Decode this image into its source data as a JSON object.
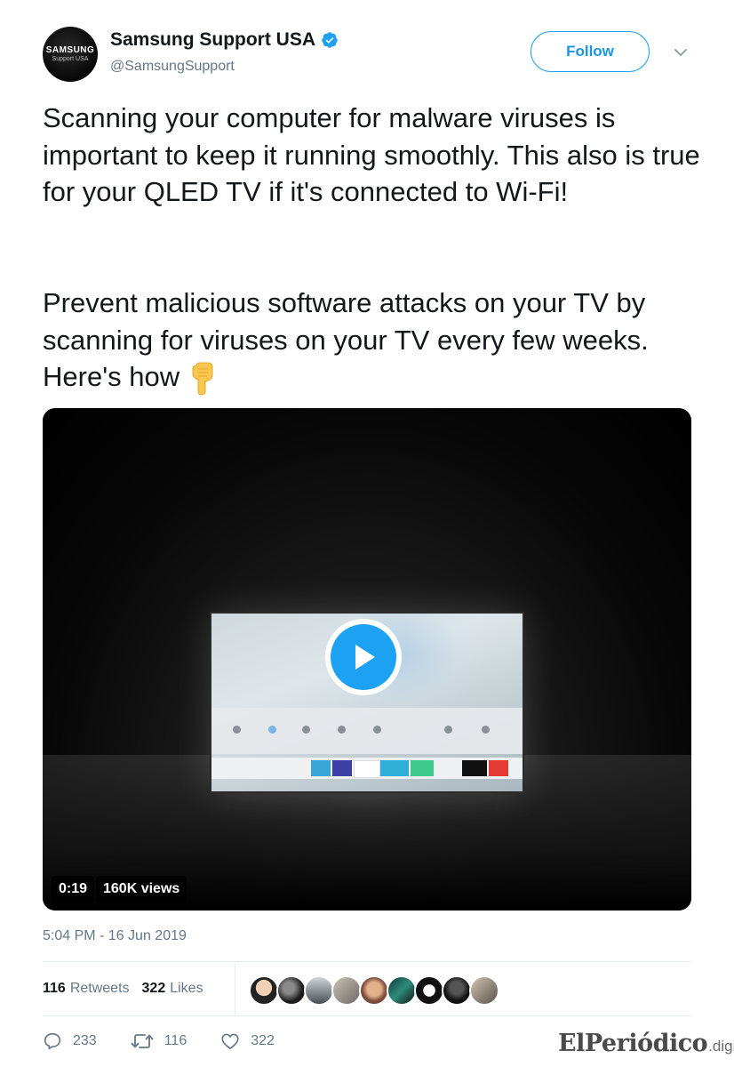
{
  "account": {
    "avatar_brand": "SAMSUNG",
    "avatar_sub": "Support USA",
    "display_name": "Samsung Support USA",
    "handle": "@SamsungSupport",
    "verified": true
  },
  "header": {
    "follow_label": "Follow"
  },
  "tweet": {
    "paragraph_1": "Scanning your computer for malware viruses is important to keep it running smoothly. This also is true for your QLED TV if it's connected to Wi-Fi!",
    "paragraph_2": "Prevent malicious software attacks on your TV by scanning for viruses on your TV every few weeks. Here's how",
    "emoji": "backhand-index-pointing-down"
  },
  "video": {
    "duration": "0:19",
    "views": "160K views"
  },
  "meta": {
    "timestamp": "5:04 PM - 16 Jun 2019"
  },
  "stats": {
    "retweets_count": "116",
    "retweets_label": "Retweets",
    "likes_count": "322",
    "likes_label": "Likes"
  },
  "actions": {
    "replies": "233",
    "retweets": "116",
    "likes": "322"
  },
  "watermark": {
    "main": "ElPeriódico",
    "sub": ".digital"
  },
  "colors": {
    "accent": "#1da1f2",
    "follow_text": "#1b95e0",
    "secondary_text": "#657786",
    "primary_text": "#14171a"
  }
}
